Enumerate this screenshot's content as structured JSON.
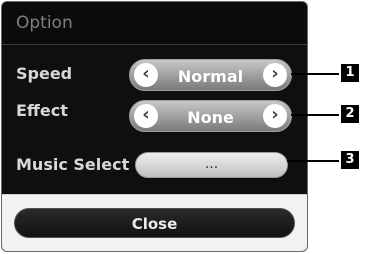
{
  "dialog": {
    "title": "Option",
    "rows": [
      {
        "label": "Speed",
        "value": "Normal"
      },
      {
        "label": "Effect",
        "value": "None"
      }
    ],
    "music_select": {
      "label": "Music Select",
      "button": "..."
    },
    "close_label": "Close"
  },
  "icons": {
    "prev": "‹",
    "next": "›"
  },
  "callouts": [
    "1",
    "2",
    "3"
  ],
  "colors": {
    "panel_bg": "#0f0f0f",
    "callout": "#000000"
  }
}
